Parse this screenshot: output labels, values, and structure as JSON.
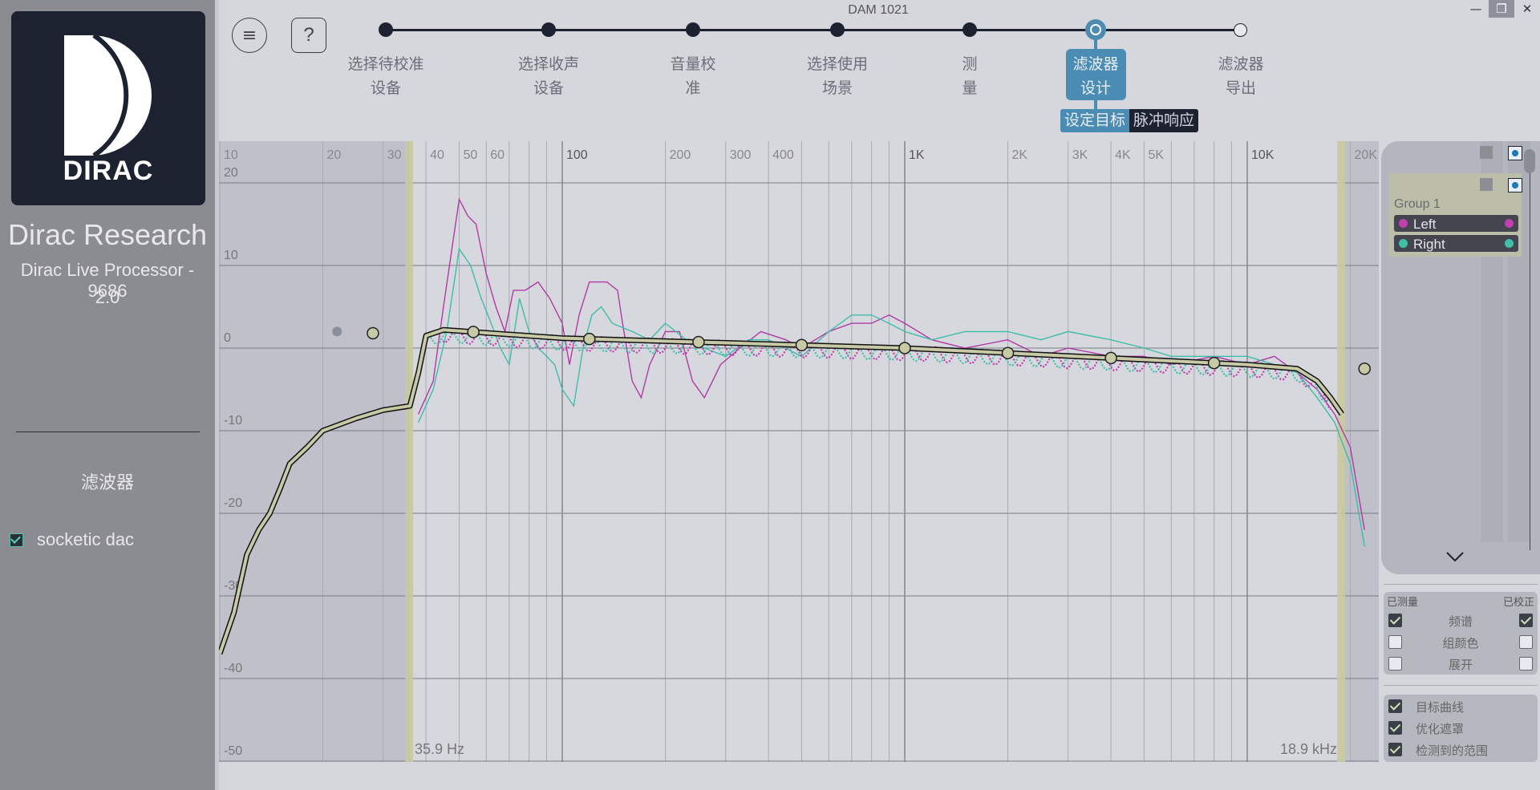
{
  "window": {
    "title": "DAM 1021",
    "controls": {
      "minimize": "—",
      "restore": "❐",
      "close": "✕"
    }
  },
  "sidebar": {
    "logo_text": "DIRAC",
    "company": "Dirac Research",
    "product": "Dirac Live Processor - 9686",
    "version": "2.0",
    "filters_label": "滤波器",
    "devices": [
      {
        "label": "socketic dac",
        "checked": true
      }
    ]
  },
  "nav": {
    "menu_icon": "≡",
    "help_icon": "?",
    "steps": [
      {
        "line1": "选择待校准",
        "line2": "设备",
        "state": "done"
      },
      {
        "line1": "选择收声",
        "line2": "设备",
        "state": "done"
      },
      {
        "line1": "音量校",
        "line2": "准",
        "state": "done"
      },
      {
        "line1": "选择使用",
        "line2": "场景",
        "state": "done"
      },
      {
        "line1": "测",
        "line2": "量",
        "state": "done"
      },
      {
        "line1": "滤波器",
        "line2": "设计",
        "state": "active"
      },
      {
        "line1": "滤波器",
        "line2": "导出",
        "state": "pending"
      }
    ],
    "subtabs": [
      {
        "label": "设定目标",
        "active": true
      },
      {
        "label": "脉冲响应",
        "active": false
      }
    ]
  },
  "chart_data": {
    "type": "line",
    "title": "",
    "xscale": "log",
    "xlim": [
      10,
      22000
    ],
    "ylim": [
      -50,
      22
    ],
    "grid": true,
    "x_tick_labels": [
      {
        "f": 10,
        "label": "10"
      },
      {
        "f": 20,
        "label": "20"
      },
      {
        "f": 30,
        "label": "30"
      },
      {
        "f": 40,
        "label": "40"
      },
      {
        "f": 50,
        "label": "50"
      },
      {
        "f": 60,
        "label": "60"
      },
      {
        "f": 100,
        "label": "100"
      },
      {
        "f": 200,
        "label": "200"
      },
      {
        "f": 300,
        "label": "300"
      },
      {
        "f": 400,
        "label": "400"
      },
      {
        "f": 1000,
        "label": "1K"
      },
      {
        "f": 2000,
        "label": "2K"
      },
      {
        "f": 3000,
        "label": "3K"
      },
      {
        "f": 4000,
        "label": "4K"
      },
      {
        "f": 5000,
        "label": "5K"
      },
      {
        "f": 10000,
        "label": "10K"
      },
      {
        "f": 20000,
        "label": "20K"
      }
    ],
    "y_ticks": [
      20,
      10,
      0,
      -10,
      -20,
      -30,
      -40,
      -50
    ],
    "optimization_range": {
      "low_hz": 35.9,
      "high_hz": 18900,
      "low_label": "35.9 Hz",
      "high_label": "18.9 kHz"
    },
    "series": [
      {
        "name": "Left measured",
        "color": "#b03aa6",
        "points": [
          [
            38,
            -8
          ],
          [
            42,
            -4
          ],
          [
            45,
            5
          ],
          [
            48,
            13
          ],
          [
            50,
            18
          ],
          [
            53,
            16
          ],
          [
            56,
            15
          ],
          [
            60,
            9
          ],
          [
            64,
            5
          ],
          [
            68,
            2
          ],
          [
            72,
            7
          ],
          [
            78,
            7
          ],
          [
            85,
            8
          ],
          [
            92,
            6
          ],
          [
            100,
            3
          ],
          [
            105,
            -2
          ],
          [
            112,
            4
          ],
          [
            120,
            8
          ],
          [
            135,
            8
          ],
          [
            145,
            7
          ],
          [
            150,
            3
          ],
          [
            160,
            -4
          ],
          [
            170,
            -6
          ],
          [
            180,
            -2
          ],
          [
            200,
            2
          ],
          [
            220,
            2
          ],
          [
            240,
            -4
          ],
          [
            260,
            -6
          ],
          [
            290,
            -2
          ],
          [
            330,
            0
          ],
          [
            380,
            2
          ],
          [
            450,
            1
          ],
          [
            500,
            0
          ],
          [
            600,
            2
          ],
          [
            700,
            3
          ],
          [
            800,
            3
          ],
          [
            900,
            4
          ],
          [
            1000,
            3
          ],
          [
            1200,
            1
          ],
          [
            1500,
            0
          ],
          [
            2000,
            1
          ],
          [
            2500,
            -1
          ],
          [
            3000,
            0
          ],
          [
            4000,
            -1
          ],
          [
            5000,
            -1
          ],
          [
            6000,
            -2
          ],
          [
            8000,
            -1
          ],
          [
            10000,
            -2
          ],
          [
            12000,
            -1
          ],
          [
            14000,
            -3
          ],
          [
            16000,
            -5
          ],
          [
            18000,
            -8
          ],
          [
            20000,
            -12
          ],
          [
            22000,
            -22
          ]
        ]
      },
      {
        "name": "Right measured",
        "color": "#3fbca8",
        "points": [
          [
            38,
            -9
          ],
          [
            42,
            -5
          ],
          [
            46,
            2
          ],
          [
            50,
            12
          ],
          [
            54,
            10
          ],
          [
            58,
            6
          ],
          [
            62,
            3
          ],
          [
            66,
            0
          ],
          [
            70,
            -2
          ],
          [
            75,
            6
          ],
          [
            80,
            2
          ],
          [
            85,
            0
          ],
          [
            90,
            -1
          ],
          [
            95,
            -2
          ],
          [
            100,
            -5
          ],
          [
            108,
            -7
          ],
          [
            115,
            0
          ],
          [
            122,
            4
          ],
          [
            130,
            5
          ],
          [
            140,
            3
          ],
          [
            160,
            2
          ],
          [
            180,
            1
          ],
          [
            200,
            3
          ],
          [
            230,
            1
          ],
          [
            260,
            0
          ],
          [
            300,
            -1
          ],
          [
            350,
            1
          ],
          [
            400,
            1
          ],
          [
            500,
            -1
          ],
          [
            600,
            2
          ],
          [
            700,
            4
          ],
          [
            800,
            4
          ],
          [
            900,
            3
          ],
          [
            1000,
            2
          ],
          [
            1200,
            1
          ],
          [
            1500,
            2
          ],
          [
            2000,
            2
          ],
          [
            2500,
            1
          ],
          [
            3000,
            2
          ],
          [
            4000,
            1
          ],
          [
            5000,
            0
          ],
          [
            6000,
            -1
          ],
          [
            8000,
            -1
          ],
          [
            10000,
            -1
          ],
          [
            12000,
            -2
          ],
          [
            14000,
            -3
          ],
          [
            16000,
            -6
          ],
          [
            18000,
            -9
          ],
          [
            20000,
            -14
          ],
          [
            22000,
            -24
          ]
        ]
      },
      {
        "name": "Target curve",
        "color": "#c8c9a6",
        "points": [
          [
            10,
            -37
          ],
          [
            11,
            -32
          ],
          [
            12,
            -25
          ],
          [
            13,
            -22
          ],
          [
            14,
            -20
          ],
          [
            15,
            -17
          ],
          [
            16,
            -14
          ],
          [
            18,
            -12
          ],
          [
            20,
            -10
          ],
          [
            25,
            -8.5
          ],
          [
            30,
            -7.5
          ],
          [
            35.9,
            -7
          ],
          [
            38,
            -3
          ],
          [
            40,
            1.5
          ],
          [
            45,
            2.2
          ],
          [
            100,
            1.2
          ],
          [
            1000,
            0
          ],
          [
            10000,
            -2
          ],
          [
            14000,
            -2.5
          ],
          [
            16000,
            -4
          ],
          [
            17500,
            -6
          ],
          [
            18900,
            -8
          ]
        ]
      }
    ],
    "target_control_points_hz": [
      22,
      28,
      55,
      120,
      250,
      500,
      1000,
      2000,
      4000,
      8000,
      22000
    ],
    "legend": "right-panel"
  },
  "channels_panel": {
    "group_name": "Group 1",
    "channels": [
      {
        "name": "Left",
        "color": "#c040b0"
      },
      {
        "name": "Right",
        "color": "#40c0a8"
      }
    ],
    "expand_icon": "chevron-down"
  },
  "display_options": {
    "header_left": "已测量",
    "header_right": "已校正",
    "rows": [
      {
        "label": "频谱",
        "measured": true,
        "corrected": true
      },
      {
        "label": "组颜色",
        "measured": false,
        "corrected": false
      },
      {
        "label": "展开",
        "measured": false,
        "corrected": false
      }
    ],
    "overlays": [
      {
        "label": "目标曲线",
        "checked": true
      },
      {
        "label": "优化遮罩",
        "checked": true
      },
      {
        "label": "检测到的范围",
        "checked": true
      }
    ]
  }
}
